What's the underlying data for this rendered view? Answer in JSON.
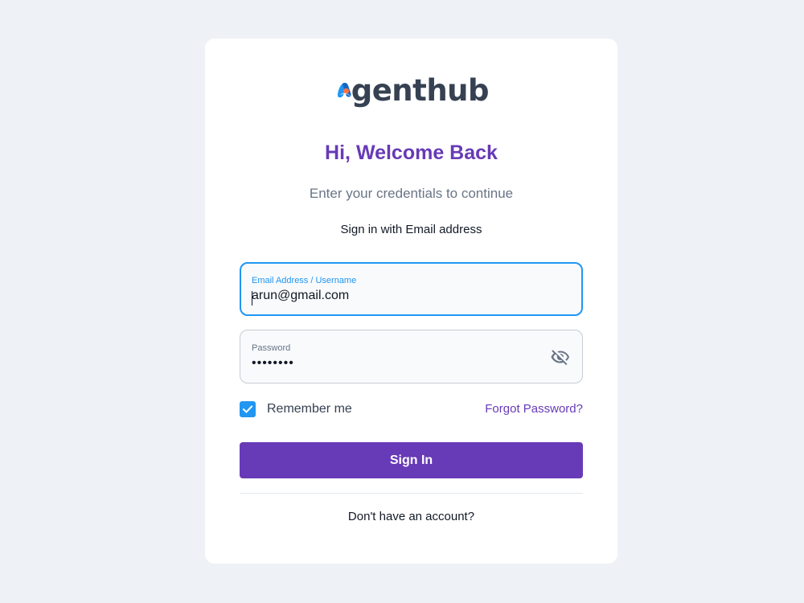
{
  "brand": {
    "logo_text": "genthub",
    "logo_icon": "agenthub-logo-mark",
    "colors": {
      "blue": "#2196f3",
      "dark": "#364152",
      "orange": "#ff7043",
      "purple": "#673ab7"
    }
  },
  "header": {
    "title": "Hi, Welcome Back",
    "subtitle": "Enter your credentials to continue",
    "signin_method": "Sign in with Email address"
  },
  "form": {
    "email": {
      "label": "Email Address / Username",
      "value": "arun@gmail.com",
      "focused": true
    },
    "password": {
      "label": "Password",
      "value": "••••••••",
      "toggle_icon": "eye-off-icon"
    },
    "remember_me": {
      "label": "Remember me",
      "checked": true
    },
    "forgot_password": "Forgot Password?",
    "submit_label": "Sign In"
  },
  "footer": {
    "register_text": "Don't have an account?"
  },
  "theme": {
    "background": "#eef2f6",
    "primary": "#673ab7",
    "focus": "#2196f3"
  }
}
